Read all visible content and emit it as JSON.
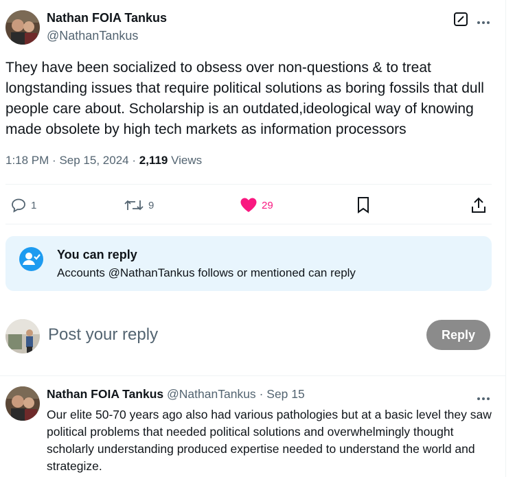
{
  "tweet": {
    "author_name": "Nathan FOIA Tankus",
    "author_handle": "@NathanTankus",
    "text": "They have been socialized to obsess over non-questions & to treat longstanding issues that require political solutions as boring fossils that dull people care about. Scholarship is an outdated,ideological way of knowing made obsolete by high tech markets as information processors",
    "time": "1:18 PM",
    "date": "Sep 15, 2024",
    "views_count": "2,119",
    "views_label": "Views",
    "separator": "·"
  },
  "actions": {
    "replies": "1",
    "retweets": "9",
    "likes": "29"
  },
  "reply_restriction": {
    "title": "You can reply",
    "subtitle": "Accounts @NathanTankus follows or mentioned can reply"
  },
  "composer": {
    "placeholder": "Post your reply",
    "button_label": "Reply"
  },
  "reply": {
    "author_name": "Nathan FOIA Tankus",
    "author_handle": "@NathanTankus",
    "separator": "·",
    "date": "Sep 15",
    "text": "Our elite 50-70 years ago also had various pathologies but at a basic level they saw political problems that needed political solutions and overwhelmingly thought scholarly understanding produced expertise needed to understand the world and strategize."
  },
  "colors": {
    "like_active": "#f91880",
    "accent": "#1d9bf0",
    "reply_button_bg": "#8b8b8b",
    "notice_bg": "#e8f5fd"
  },
  "icons": [
    "grok-icon",
    "more-icon",
    "reply-icon",
    "retweet-icon",
    "heart-icon",
    "bookmark-icon",
    "share-icon",
    "person-check-icon"
  ]
}
